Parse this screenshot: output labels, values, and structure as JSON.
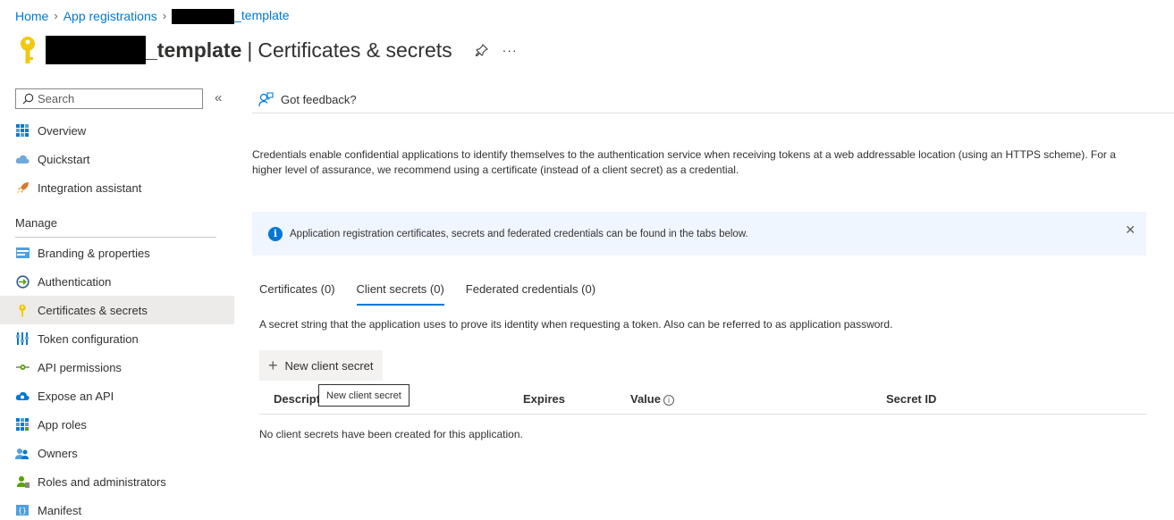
{
  "breadcrumb": {
    "home": "Home",
    "app_registrations": "App registrations",
    "app_suffix": "_template"
  },
  "header": {
    "title_suffix": "_template",
    "separator": "|",
    "page_title": "Certificates & secrets",
    "more": "···"
  },
  "sidebar": {
    "search_placeholder": "Search",
    "collapse": "«",
    "top_items": [
      {
        "label": "Overview",
        "icon": "overview-grid-icon"
      },
      {
        "label": "Quickstart",
        "icon": "quickstart-cloud-icon"
      },
      {
        "label": "Integration assistant",
        "icon": "rocket-icon"
      }
    ],
    "manage_label": "Manage",
    "manage_items": [
      {
        "label": "Branding & properties",
        "icon": "branding-icon"
      },
      {
        "label": "Authentication",
        "icon": "authentication-icon"
      },
      {
        "label": "Certificates & secrets",
        "icon": "key-icon",
        "active": true
      },
      {
        "label": "Token configuration",
        "icon": "token-config-icon"
      },
      {
        "label": "API permissions",
        "icon": "api-permissions-icon"
      },
      {
        "label": "Expose an API",
        "icon": "expose-api-cloud-icon"
      },
      {
        "label": "App roles",
        "icon": "app-roles-grid-icon"
      },
      {
        "label": "Owners",
        "icon": "owners-people-icon"
      },
      {
        "label": "Roles and administrators",
        "icon": "roles-admins-icon"
      },
      {
        "label": "Manifest",
        "icon": "manifest-icon"
      }
    ]
  },
  "toolbar": {
    "feedback": "Got feedback?"
  },
  "main": {
    "description": "Credentials enable confidential applications to identify themselves to the authentication service when receiving tokens at a web addressable location (using an HTTPS scheme). For a higher level of assurance, we recommend using a certificate (instead of a client secret) as a credential.",
    "info_text": "Application registration certificates, secrets and federated credentials can be found in the tabs below.",
    "info_close": "✕",
    "tabs": [
      {
        "label": "Certificates (0)"
      },
      {
        "label": "Client secrets (0)",
        "active": true
      },
      {
        "label": "Federated credentials (0)"
      }
    ],
    "tab_description": "A secret string that the application uses to prove its identity when requesting a token. Also can be referred to as application password.",
    "new_secret_label": "New client secret",
    "columns": {
      "description": "Descripti",
      "expires": "Expires",
      "value": "Value",
      "secret_id": "Secret ID"
    },
    "tooltip": "New client secret",
    "empty_message": "No client secrets have been created for this application."
  },
  "colors": {
    "accent": "#0078d4",
    "info_bg": "#f0f6ff",
    "active_nav_bg": "#edebe9",
    "key_yellow": "#f2c811"
  }
}
